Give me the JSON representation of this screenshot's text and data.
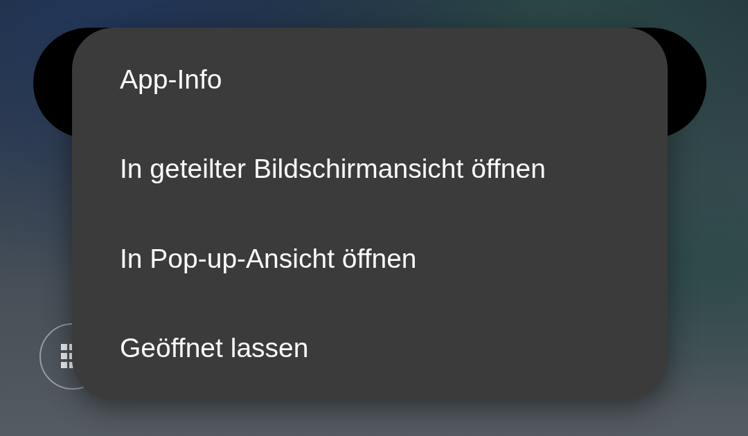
{
  "menu": {
    "items": [
      {
        "label": "App-Info"
      },
      {
        "label": "In geteilter Bildschirmansicht öffnen"
      },
      {
        "label": "In Pop-up-Ansicht öffnen"
      },
      {
        "label": "Geöffnet lassen"
      }
    ]
  }
}
